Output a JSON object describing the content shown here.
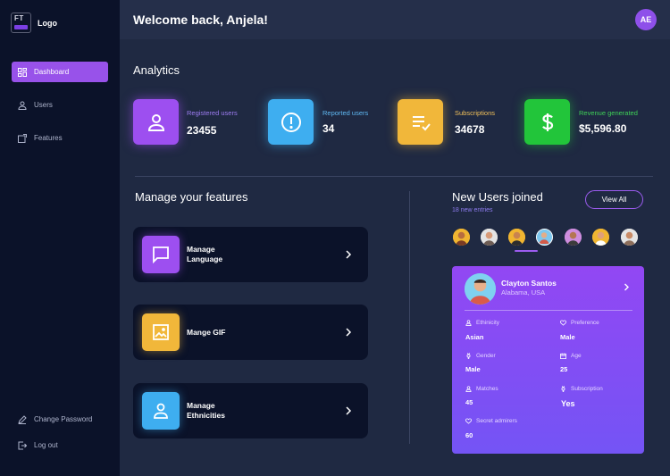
{
  "logo": {
    "mark": "FT",
    "text": "Logo"
  },
  "sidebar": {
    "items": [
      {
        "label": "Dashboard",
        "icon": "grid-icon"
      },
      {
        "label": "Users",
        "icon": "user-icon"
      },
      {
        "label": "Features",
        "icon": "features-icon"
      }
    ],
    "bottom": [
      {
        "label": "Change Password",
        "icon": "pencil-icon"
      },
      {
        "label": "Log out",
        "icon": "logout-icon"
      }
    ]
  },
  "header": {
    "welcome": "Welcome back, Anjela!",
    "avatar_initials": "AE"
  },
  "analytics": {
    "title": "Analytics",
    "stats": [
      {
        "label": "Registered users",
        "value": "23455",
        "icon": "user-icon",
        "color": "#9d4ff0"
      },
      {
        "label": "Reported users",
        "value": "34",
        "icon": "alert-icon",
        "color": "#3eaef0"
      },
      {
        "label": "Subscriptions",
        "value": "34678",
        "icon": "list-check-icon",
        "color": "#f1b73a"
      },
      {
        "label": "Revenue generated",
        "value": "$5,596.80",
        "icon": "dollar-icon",
        "color": "#22c53a"
      }
    ]
  },
  "features": {
    "title": "Manage your features",
    "items": [
      {
        "label_line1": "Manage",
        "label_line2": "Language",
        "icon": "chat-icon",
        "color": "#9d4ff0"
      },
      {
        "label_line1": "Mange GIF",
        "label_line2": "",
        "icon": "image-icon",
        "color": "#f1b73a"
      },
      {
        "label_line1": "Manage",
        "label_line2": "Ethnicities",
        "icon": "person-icon",
        "color": "#3eaef0"
      }
    ]
  },
  "new_users": {
    "title": "New Users joined",
    "entries": "18 new entries",
    "view_all": "View All",
    "selected_index": 2
  },
  "profile": {
    "name": "Clayton Santos",
    "location": "Alabama, USA",
    "attributes": [
      {
        "label": "Ethinicity",
        "value": "Asian",
        "icon": "person-icon"
      },
      {
        "label": "Preference",
        "value": "Male",
        "icon": "heart-icon"
      },
      {
        "label": "Gender",
        "value": "Male",
        "icon": "gender-icon"
      },
      {
        "label": "Age",
        "value": "25",
        "icon": "calendar-icon"
      },
      {
        "label": "Matches",
        "value": "45",
        "icon": "people-icon"
      },
      {
        "label": "Subscription",
        "value": "Yes",
        "icon": "gender-icon"
      },
      {
        "label": "Secret admirers",
        "value": "60",
        "icon": "heart-icon"
      }
    ]
  }
}
